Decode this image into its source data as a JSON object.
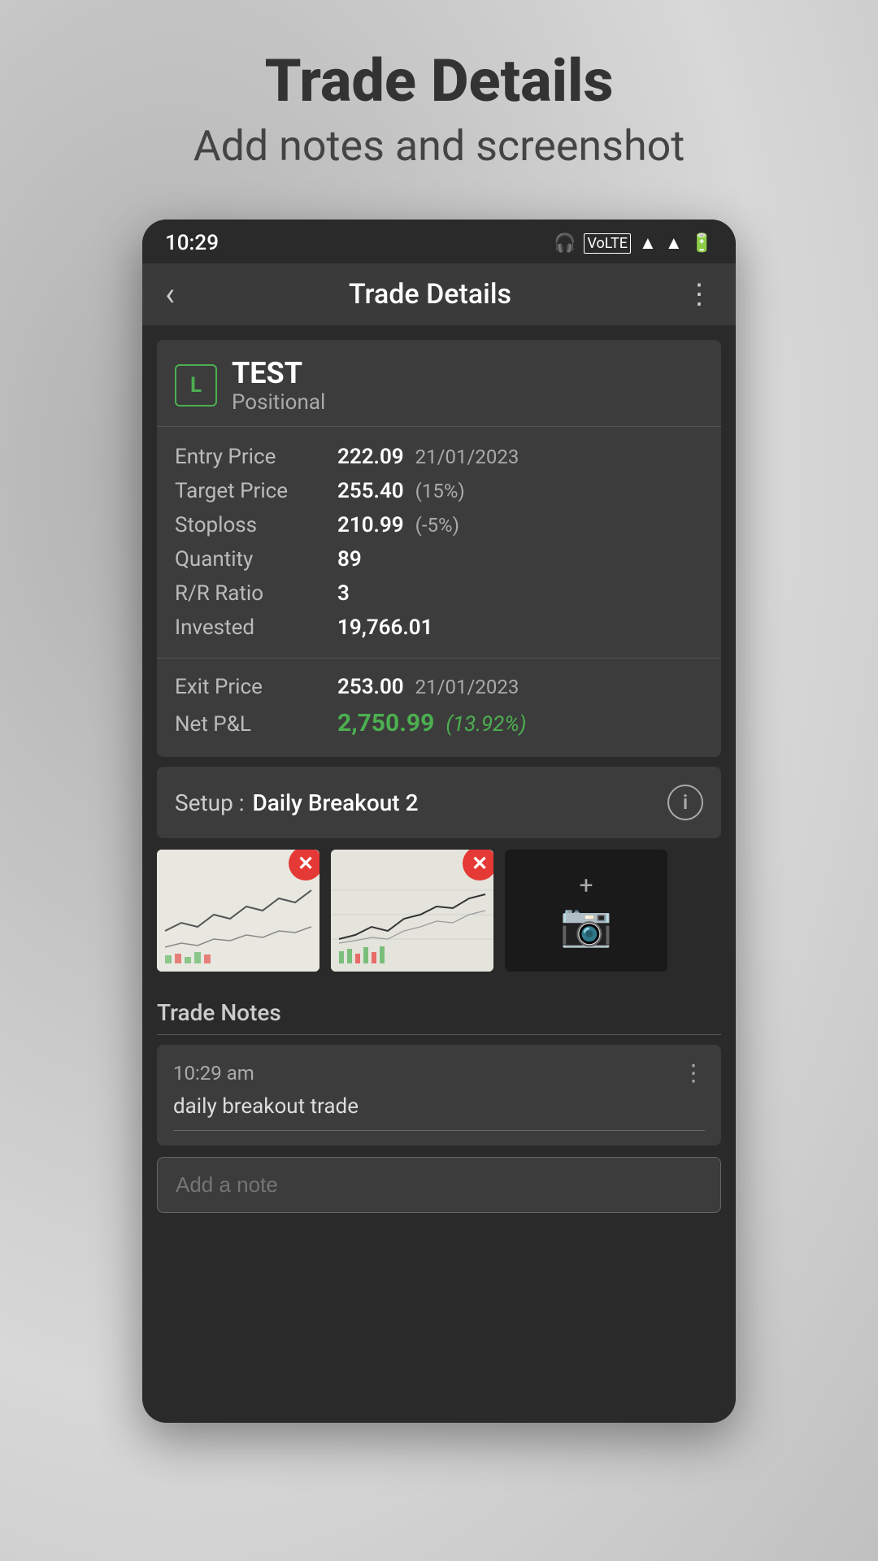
{
  "pageHeader": {
    "title": "Trade Details",
    "subtitle": "Add notes and screenshot"
  },
  "statusBar": {
    "time": "10:29",
    "icons": [
      "headset",
      "volte",
      "wifi",
      "signal",
      "signal2",
      "battery"
    ]
  },
  "topBar": {
    "title": "Trade Details",
    "backLabel": "‹",
    "moreLabel": "⋮"
  },
  "trade": {
    "badge": "L",
    "name": "TEST",
    "type": "Positional",
    "entryPrice": "222.09",
    "entryDate": "21/01/2023",
    "targetPrice": "255.40",
    "targetPct": "(15%)",
    "stoploss": "210.99",
    "stoplossNeg": "(-5%)",
    "quantity": "89",
    "rrRatio": "3",
    "invested": "19,766.01",
    "exitPrice": "253.00",
    "exitDate": "21/01/2023",
    "netPnl": "2,750.99",
    "netPnlPct": "(13.92%)"
  },
  "labels": {
    "entryPrice": "Entry Price",
    "targetPrice": "Target Price",
    "stoploss": "Stoploss",
    "quantity": "Quantity",
    "rrRatio": "R/R Ratio",
    "invested": "Invested",
    "exitPrice": "Exit Price",
    "netPnl": "Net P&L",
    "setup": "Setup :",
    "setupName": "Daily Breakout 2",
    "tradeNotes": "Trade Notes",
    "noteTime": "10:29 am",
    "noteText": "daily breakout trade",
    "addNotePlaceholder": "Add a note"
  }
}
